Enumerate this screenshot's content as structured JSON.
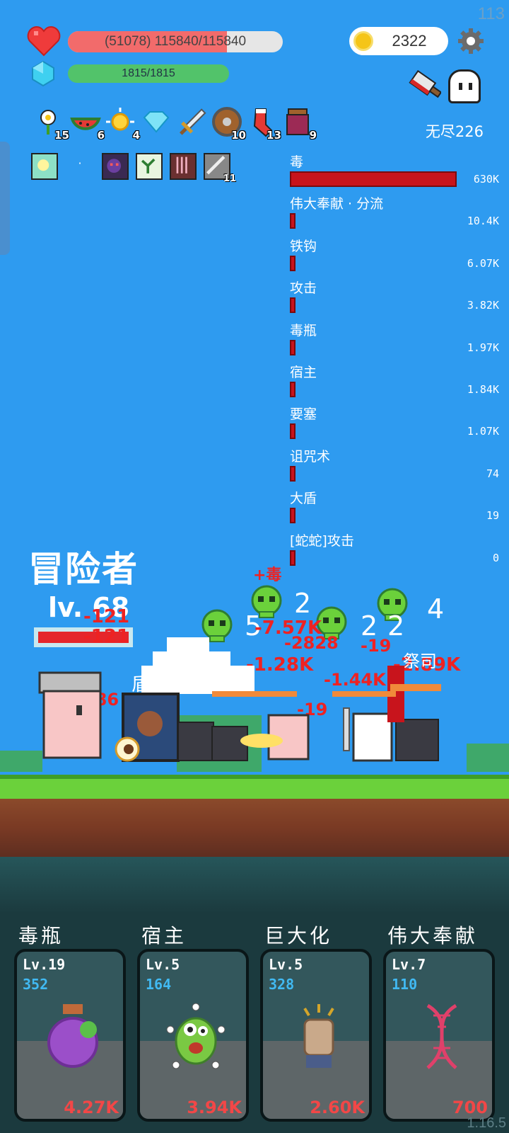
{
  "fps": "113",
  "hp": {
    "text": "(51078) 115840/115840",
    "fill_fraction": 0.74
  },
  "mp": {
    "text": "1815/1815"
  },
  "coins": "2322",
  "mode_label": "无尽226",
  "items": [
    {
      "icon": "flower-icon",
      "count": "15"
    },
    {
      "icon": "watermelon-icon",
      "count": "6"
    },
    {
      "icon": "sun-icon",
      "count": "4"
    },
    {
      "icon": "diamond-icon",
      "count": ""
    },
    {
      "icon": "sword-icon",
      "count": ""
    },
    {
      "icon": "shield-round-icon",
      "count": "10"
    },
    {
      "icon": "sock-icon",
      "count": "13"
    },
    {
      "icon": "jam-jar-icon",
      "count": "9"
    }
  ],
  "buffs": [
    {
      "icon": "light-buff-icon",
      "count": ""
    },
    {
      "icon": "dark-beast-buff-icon",
      "count": ""
    },
    {
      "icon": "sprout-buff-icon",
      "count": ""
    },
    {
      "icon": "claw-buff-icon",
      "count": ""
    },
    {
      "icon": "blade-buff-icon",
      "count": "11"
    }
  ],
  "damage_stats": [
    {
      "name": "毒",
      "value": "630K",
      "fraction": 1.0
    },
    {
      "name": "伟大奉献 · 分流",
      "value": "10.4K",
      "fraction": 0.016
    },
    {
      "name": "铁钩",
      "value": "6.07K",
      "fraction": 0.0096
    },
    {
      "name": "攻击",
      "value": "3.82K",
      "fraction": 0.006
    },
    {
      "name": "毒瓶",
      "value": "1.97K",
      "fraction": 0.003
    },
    {
      "name": "宿主",
      "value": "1.84K",
      "fraction": 0.003
    },
    {
      "name": "要塞",
      "value": "1.07K",
      "fraction": 0.002
    },
    {
      "name": "诅咒术",
      "value": "74",
      "fraction": 0.001
    },
    {
      "name": "大盾",
      "value": "19",
      "fraction": 0.001
    },
    {
      "name": "[蛇蛇]攻击",
      "value": "0",
      "fraction": 0.001
    }
  ],
  "adventurer": {
    "name": "冒险者",
    "level": "lv. 68"
  },
  "battle": {
    "poison_label": "+毒",
    "dmg_a": "-121",
    "dmg_b": "-121",
    "dmg_c": "-186",
    "dmg_d": "-7.57K",
    "dmg_e": "-2828",
    "dmg_f": "-19",
    "dmg_g": "-1.44K",
    "dmg_h": "-2.89K",
    "dmg_i": "-1.28K",
    "dmg_j": "-19",
    "skull_count_a": "5",
    "skull_count_b": "2",
    "skull_count_c": "2",
    "skull_count_d": "2",
    "skull_count_e": "4",
    "enemy_label": "祭司",
    "shield_label": "盾"
  },
  "skills": [
    {
      "title": "毒瓶",
      "level": "Lv.19",
      "value": "352",
      "cost": "4.27K"
    },
    {
      "title": "宿主",
      "level": "Lv.5",
      "value": "164",
      "cost": "3.94K"
    },
    {
      "title": "巨大化",
      "level": "Lv.5",
      "value": "328",
      "cost": "2.60K"
    },
    {
      "title": "伟大奉献",
      "level": "Lv.7",
      "value": "110",
      "cost": "700"
    }
  ],
  "version": "1.16.5",
  "colors": {
    "sky": "#2e9bf0",
    "hp": "#f26b6b",
    "mp": "#52c36a",
    "damage": "#ee2222",
    "grass": "#6bd13b"
  }
}
